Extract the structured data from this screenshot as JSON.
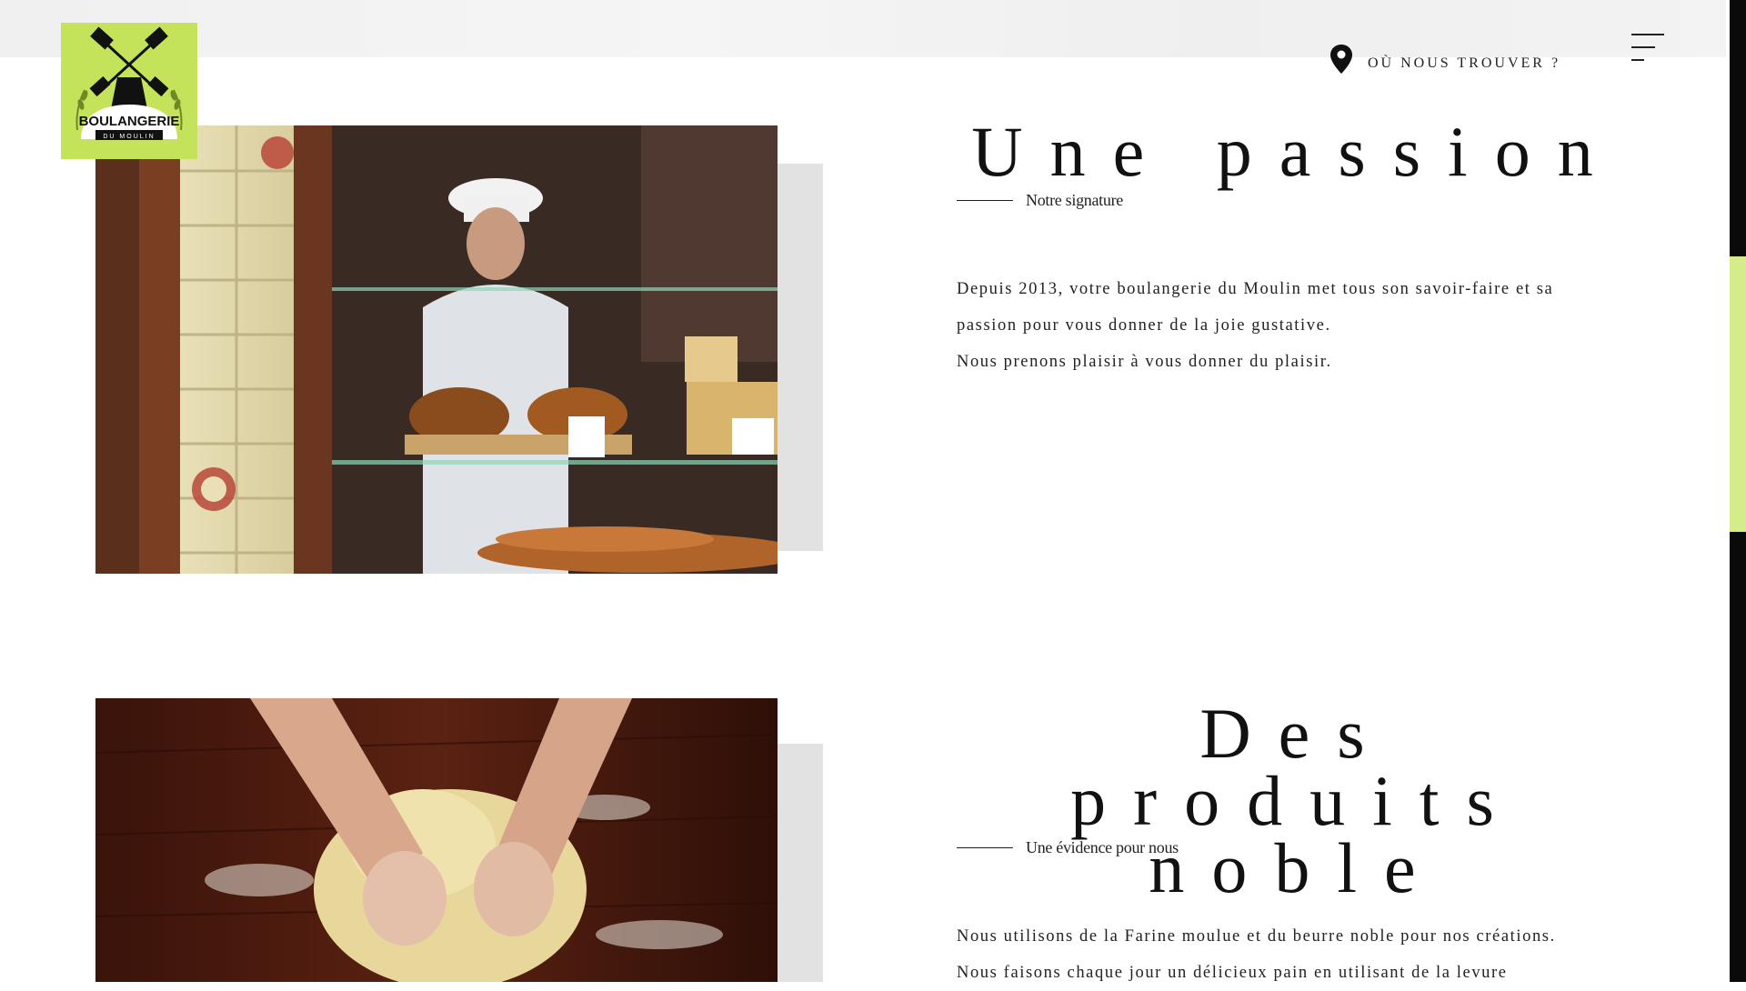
{
  "header": {
    "brand": {
      "name": "BOULANGERIE",
      "tagline": "DU MOULIN",
      "background_color": "#c5e35a"
    },
    "find_us_label": "OÙ NOUS TROUVER ?",
    "find_us_icon": "map-pin-icon",
    "menu_icon": "hamburger-menu-icon"
  },
  "sections": [
    {
      "title": "Une passion",
      "subtitle": "Notre signature",
      "paragraphs": [
        "Depuis 2013, votre boulangerie du Moulin met tous son savoir-faire et sa passion pour vous donner de la joie gustative.",
        "Nous prenons plaisir à vous donner du plaisir."
      ]
    },
    {
      "title": "Des produits noble",
      "subtitle": "Une évidence pour nous",
      "paragraphs": [
        "Nous utilisons de la Farine moulue et du beurre noble pour nos créations.",
        "Nous faisons chaque jour un délicieux pain en utilisant de la levure"
      ]
    }
  ],
  "scrollbar": {
    "thumb_color": "#d4ec8a"
  }
}
